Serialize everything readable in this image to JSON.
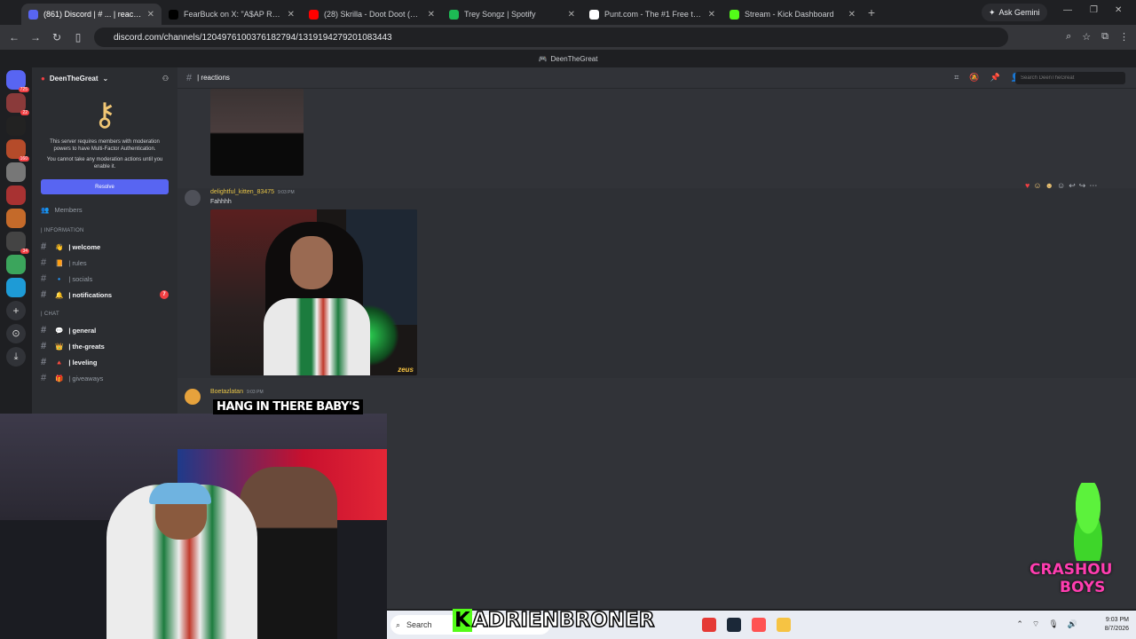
{
  "browser": {
    "tabs": [
      {
        "title": "(861) Discord | # ... | reactions",
        "color": "#5865f2",
        "active": true
      },
      {
        "title": "FearBuck on X: \"A$AP Rocky gi...",
        "color": "#000000",
        "active": false
      },
      {
        "title": "(28) Skrilla - Doot Doot (6 7) (O...",
        "color": "#ff0000",
        "active": false
      },
      {
        "title": "Trey Songz | Spotify",
        "color": "#1db954",
        "active": false
      },
      {
        "title": "Punt.com - The #1 Free to Play ...",
        "color": "#ffffff",
        "active": false
      },
      {
        "title": "Stream - Kick Dashboard",
        "color": "#53fc18",
        "active": false
      }
    ],
    "new_tab": "+",
    "ask_gemini": "Ask Gemini",
    "url": "discord.com/channels/1204976100376182794/1319194279201083443"
  },
  "discord": {
    "window_title": "DeenTheGreat",
    "server_name": "DeenTheGreat",
    "mfa_text": "This server requires members with moderation powers to have Multi-Factor Authentication.",
    "mfa_text2": "You cannot take any moderation actions until you enable it.",
    "resolve_label": "Resolve",
    "members_label": "Members",
    "categories": {
      "information": "| INFORMATION",
      "chat": "| CHAT"
    },
    "channels_info": [
      {
        "name": "| welcome",
        "bold": true,
        "emoji": "👋"
      },
      {
        "name": "| rules",
        "bold": false,
        "emoji": "📙"
      },
      {
        "name": "| socials",
        "bold": false,
        "emoji": "🔹"
      },
      {
        "name": "| notifications",
        "bold": true,
        "emoji": "🔔",
        "badge": "7"
      }
    ],
    "channels_chat": [
      {
        "name": "| general",
        "bold": true,
        "emoji": "💬"
      },
      {
        "name": "| the-greats",
        "bold": true,
        "emoji": "👑"
      },
      {
        "name": "| leveling",
        "bold": true,
        "emoji": "🔺"
      },
      {
        "name": "| giveaways",
        "bold": false,
        "emoji": "🎁"
      }
    ],
    "guild_badges": [
      "725",
      "22",
      "160",
      "34"
    ],
    "channel_header": "| reactions",
    "search_placeholder": "Search DeenTheGreat",
    "messages": [
      {
        "user": "delightful_kitten_83475",
        "time": "9:03 PM",
        "text": "Fahhhh",
        "image_watermark": "zeus"
      },
      {
        "user": "Boetazlatan",
        "time": "9:03 PM"
      }
    ]
  },
  "overlay": {
    "caption": "HANG IN THERE BABY'S",
    "streamer_name": "KADRIENBRONER",
    "streamer_k": "K",
    "crash_line1": "CRASHOU",
    "crash_line2": "BOYS"
  },
  "taskbar": {
    "search_label": "Search",
    "time": "9:03 PM",
    "date": "8/7/2026"
  }
}
